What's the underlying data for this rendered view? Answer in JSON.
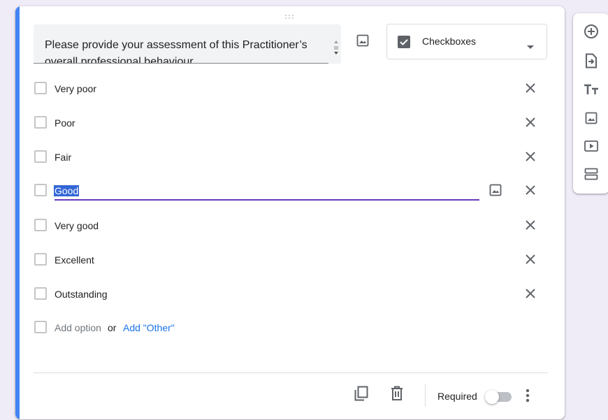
{
  "question": {
    "text": "Please provide your assessment of this Practitioner’s overall professional behaviour"
  },
  "question_type": {
    "selected": "Checkboxes"
  },
  "options": [
    {
      "label": "Very poor"
    },
    {
      "label": "Poor"
    },
    {
      "label": "Fair"
    },
    {
      "label": "Good",
      "active": true
    },
    {
      "label": "Very good"
    },
    {
      "label": "Excellent"
    },
    {
      "label": "Outstanding"
    }
  ],
  "add_row": {
    "add_option": "Add option",
    "or": "or",
    "add_other": "Add \"Other\""
  },
  "footer": {
    "required_label": "Required",
    "required_on": false
  },
  "colors": {
    "accent": "#4285f4",
    "active_underline": "#673ab7",
    "selection": "#3367d6",
    "link": "#1a73e8",
    "icon": "#5f6368"
  },
  "side_toolbar": {
    "tools": [
      "add-question-icon",
      "import-questions-icon",
      "add-title-icon",
      "add-image-icon",
      "add-video-icon",
      "add-section-icon"
    ]
  }
}
